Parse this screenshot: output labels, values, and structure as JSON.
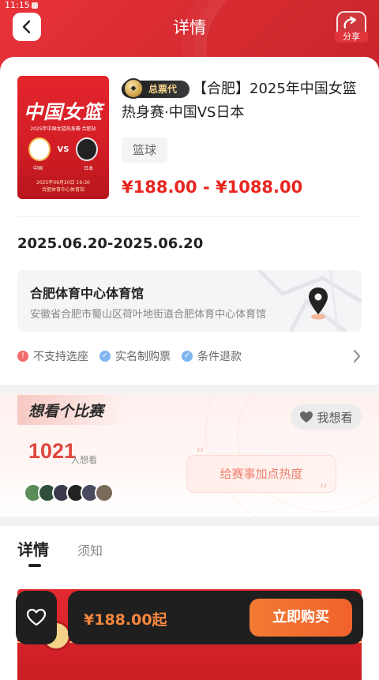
{
  "status_bar": {
    "time": "11:15"
  },
  "header": {
    "title": "详情",
    "share_label": "分享"
  },
  "event": {
    "agent_badge": "总票代",
    "title": "【合肥】2025年中国女篮热身赛·中国VS日本",
    "tag": "篮球",
    "price_range": "¥188.00 - ¥1088.00",
    "date_range": "2025.06.20-2025.06.20"
  },
  "poster": {
    "logo_left": "",
    "logo_right": "",
    "title": "中国女篮",
    "subtitle": "2025年中国女篮热身赛·合肥站",
    "vs": "VS",
    "team_left": "中国",
    "team_right": "日本",
    "date": "2025年06月20日 19:30",
    "venue": "合肥体育中心体育馆"
  },
  "venue": {
    "name": "合肥体育中心体育馆",
    "address": "安徽省合肥市蜀山区荷叶地街道合肥体育中心体育馆"
  },
  "features": [
    {
      "label": "不支持选座",
      "icon": "exclamation-icon",
      "color": "#f26b6b"
    },
    {
      "label": "实名制购票",
      "icon": "check-icon",
      "color": "#7fb4ee"
    },
    {
      "label": "条件退款",
      "icon": "check-icon",
      "color": "#7fb4ee"
    }
  ],
  "want": {
    "title": "想看个比赛",
    "button_label": "我想看",
    "count": "1021",
    "count_unit": "人想看",
    "heat_prompt": "给赛事加点热度"
  },
  "tabs": {
    "detail": "详情",
    "notice": "须知"
  },
  "bottom_bar": {
    "price": "¥188.00起",
    "buy_label": "立即购买"
  },
  "colors": {
    "brand_red": "#e0333a",
    "price_red": "#e8251f",
    "buy_orange": "#f37a33"
  }
}
